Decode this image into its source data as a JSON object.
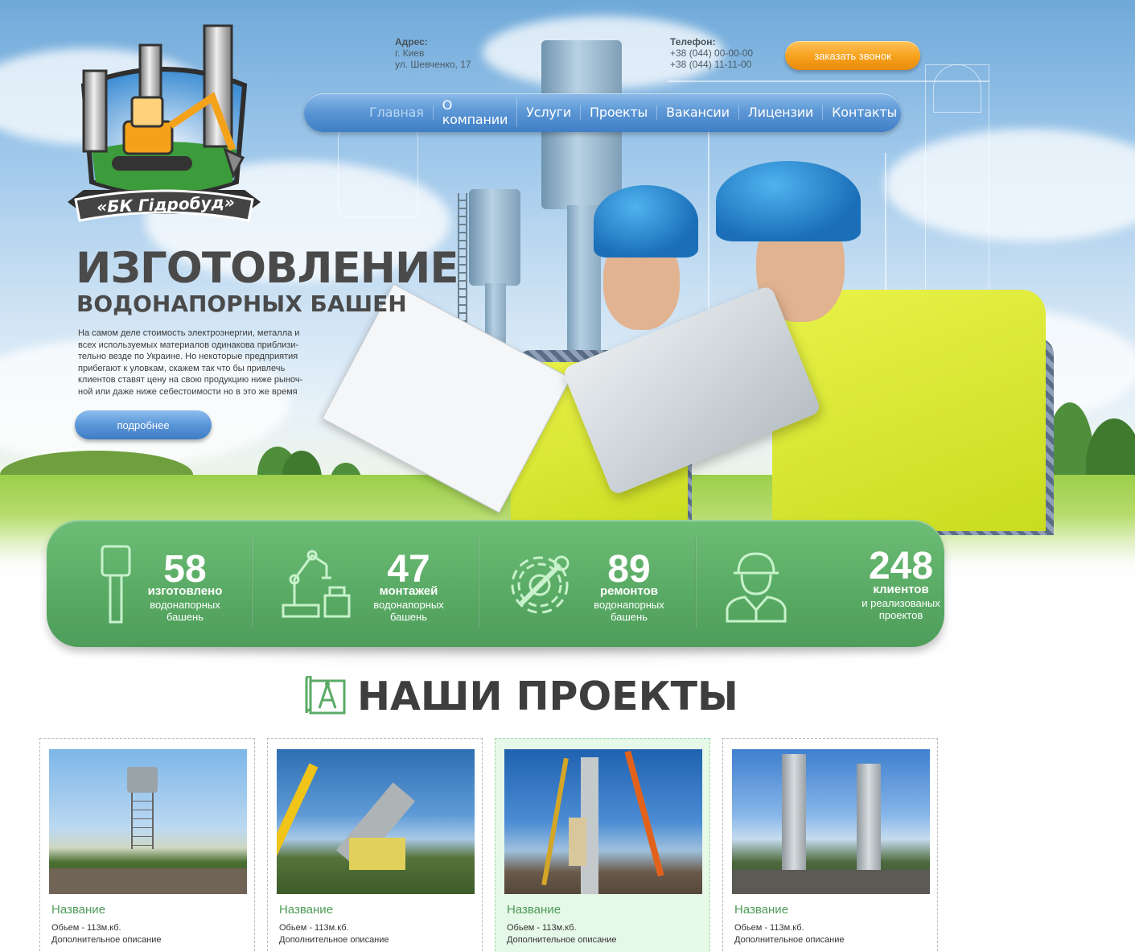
{
  "logo": {
    "text": "«БК Гідробуд»"
  },
  "contacts": {
    "address_title": "Адрес:",
    "address_city": "г. Киев",
    "address_street": "ул. Шевченко, 17",
    "phone_title": "Телефон:",
    "phone_1": "+38 (044) 00-00-00",
    "phone_2": "+38 (044) 11-11-00",
    "callback_button": "заказать звонок"
  },
  "nav": {
    "items": [
      {
        "label": "Главная",
        "active": true
      },
      {
        "label": "О компании"
      },
      {
        "label": "Услуги"
      },
      {
        "label": "Проекты"
      },
      {
        "label": "Вакансии"
      },
      {
        "label": "Лицензии"
      },
      {
        "label": "Контакты"
      }
    ]
  },
  "hero": {
    "title": "ИЗГОТОВЛЕНИЕ",
    "subtitle": "ВОДОНАПОРНЫХ БАШЕН",
    "text_lines": [
      "На самом деле стоимость электроэнергии, металла и",
      "всех используемых материалов одинакова приблизи-",
      "тельно везде по Украине. Но некоторые предприятия",
      "прибегают к уловкам, скажем так что бы привлечь",
      "клиентов  ставят цену на свою продукцию ниже рыноч-",
      "ной или даже ниже себестоимости но в это же время"
    ],
    "more_button": "подробнее"
  },
  "stats": [
    {
      "number": "58",
      "label": "изготовлено",
      "desc_1": "водонапорных",
      "desc_2": "башень",
      "icon": "water-tower-icon"
    },
    {
      "number": "47",
      "label": "монтажей",
      "desc_1": "водонапорных",
      "desc_2": "башень",
      "icon": "robot-arm-icon"
    },
    {
      "number": "89",
      "label": "ремонтов",
      "desc_1": "водонапорных",
      "desc_2": "башень",
      "icon": "gear-wrench-icon"
    },
    {
      "number": "248",
      "label": "клиентов",
      "desc_1": "и реализованых",
      "desc_2": "проектов",
      "icon": "worker-icon"
    }
  ],
  "projects": {
    "title": "НАШИ ПРОЕКТЫ",
    "cards": [
      {
        "name": "Название",
        "volume": "Обьем - 113м.кб.",
        "desc": "Дополнительное описание"
      },
      {
        "name": "Название",
        "volume": "Обьем - 113м.кб.",
        "desc": "Дополнительное описание"
      },
      {
        "name": "Название",
        "volume": "Обьем - 113м.кб.",
        "desc": "Дополнительное описание",
        "highlighted": true
      },
      {
        "name": "Название",
        "volume": "Обьем - 113м.кб.",
        "desc": "Дополнительное описание"
      }
    ]
  },
  "colors": {
    "accent_green": "#5aab65",
    "nav_blue": "#4f8ccd",
    "callback_orange": "#f7a11b",
    "card_title_green": "#4c9b57"
  }
}
